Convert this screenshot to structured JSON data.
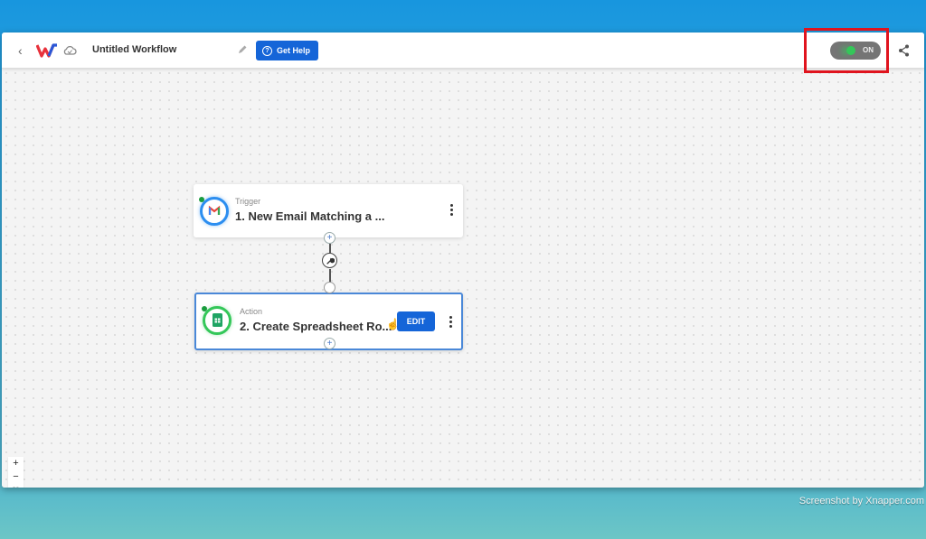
{
  "header": {
    "back_label": "‹",
    "title": "Untitled Workflow",
    "help_label": "Get Help",
    "toggle_label": "ON",
    "toggle_state": "on",
    "icons": [
      "chevron-left-icon",
      "app-logo-icon",
      "cloud-icon",
      "pencil-icon",
      "question-icon",
      "share-icon"
    ]
  },
  "workflow": {
    "nodes": [
      {
        "type": "Trigger",
        "name": "1. New Email Matching a ...",
        "app_icon": "gmail-icon",
        "status_color": "#1a9c3e"
      },
      {
        "type": "Action",
        "name": "2. Create Spreadsheet Ro...",
        "app_icon": "google-sheets-icon",
        "edit_label": "EDIT",
        "status_color": "#1a9c3e"
      }
    ],
    "add_step_label": "+",
    "filter_icon": "wrench-icon"
  },
  "zoom_controls": {
    "zoom_in": "+",
    "zoom_out": "−",
    "fit": "⛶",
    "lock": "🔒"
  },
  "colors": {
    "accent": "#1565d8",
    "toggle_on": "#34c759",
    "highlight": "#e0141e"
  },
  "watermark": "Screenshot by Xnapper.com"
}
